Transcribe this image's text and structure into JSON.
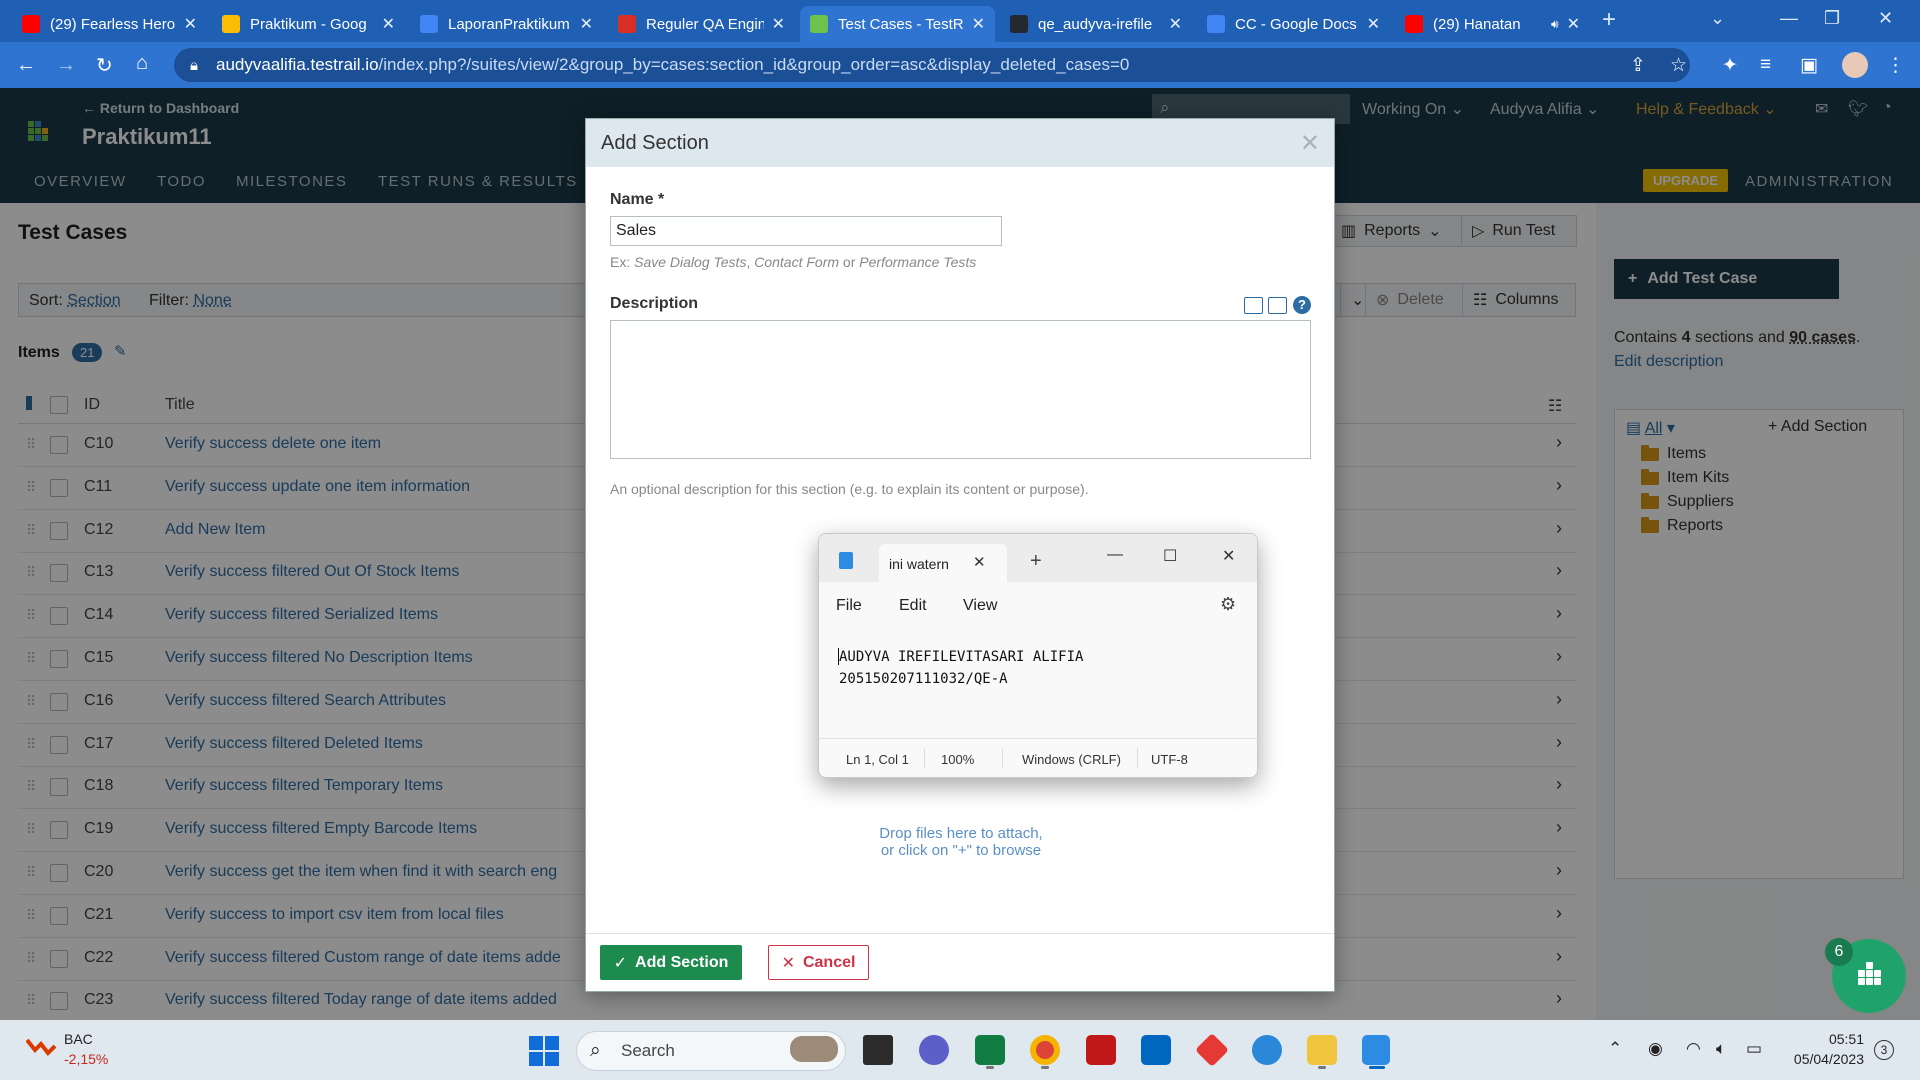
{
  "browser": {
    "tabs": [
      {
        "title": "(29) Fearless Hero",
        "icon": "youtube-icon",
        "color": "#ff0000"
      },
      {
        "title": "Praktikum - Goog",
        "icon": "drive-icon",
        "color": "#fbbc04"
      },
      {
        "title": "LaporanPraktikum",
        "icon": "docs-icon",
        "color": "#4285f4"
      },
      {
        "title": "Reguler QA Engin",
        "icon": "flask-icon",
        "color": "#d93025"
      },
      {
        "title": "Test Cases - TestR",
        "icon": "testrail-icon",
        "color": "#6cc24a"
      },
      {
        "title": "qe_audyva-irefile",
        "icon": "github-icon",
        "color": "#24292f"
      },
      {
        "title": "CC - Google Docs",
        "icon": "docs-icon",
        "color": "#4285f4"
      },
      {
        "title": "(29) Hanatan",
        "icon": "youtube-icon",
        "color": "#ff0000"
      }
    ],
    "url_host": "audyvaalifia.testrail.io",
    "url_path": "/index.php?/suites/view/2&group_by=cases:section_id&group_order=asc&display_deleted_cases=0"
  },
  "header": {
    "back_link": "← Return to Dashboard",
    "project": "Praktikum11",
    "nav": [
      "OVERVIEW",
      "TODO",
      "MILESTONES",
      "TEST RUNS & RESULTS"
    ],
    "working_on": "Working On",
    "user": "Audyva Alifia",
    "help": "Help & Feedback",
    "upgrade": "UPGRADE",
    "admin": "ADMINISTRATION"
  },
  "page": {
    "title": "Test Cases",
    "reports": "Reports",
    "run_test": "Run Test",
    "sort_label": "Sort:",
    "sort_value": "Section",
    "filter_label": "Filter:",
    "filter_value": "None",
    "delete": "Delete",
    "columns": "Columns",
    "items_label": "Items",
    "items_count": "21",
    "col_id": "ID",
    "col_title": "Title",
    "rows": [
      {
        "id": "C10",
        "title": "Verify success delete one item"
      },
      {
        "id": "C11",
        "title": "Verify success update one item information"
      },
      {
        "id": "C12",
        "title": "Add New Item"
      },
      {
        "id": "C13",
        "title": "Verify success filtered Out Of Stock Items"
      },
      {
        "id": "C14",
        "title": "Verify success filtered Serialized Items"
      },
      {
        "id": "C15",
        "title": "Verify success filtered No Description Items"
      },
      {
        "id": "C16",
        "title": "Verify success filtered Search Attributes"
      },
      {
        "id": "C17",
        "title": "Verify success filtered Deleted Items"
      },
      {
        "id": "C18",
        "title": "Verify success filtered Temporary Items"
      },
      {
        "id": "C19",
        "title": "Verify success filtered Empty Barcode Items"
      },
      {
        "id": "C20",
        "title": "Verify success get the item when find it with search eng"
      },
      {
        "id": "C21",
        "title": "Verify success to import csv item from local files"
      },
      {
        "id": "C22",
        "title": "Verify success filtered Custom range of date items adde"
      },
      {
        "id": "C23",
        "title": "Verify success filtered Today range of date items added"
      }
    ]
  },
  "sidebar": {
    "add_case": "Add Test Case",
    "contains_pre": "Contains ",
    "sections_count": "4",
    "contains_mid": " sections and ",
    "cases_count": "90 cases",
    "contains_post": ".",
    "edit_desc": "Edit description",
    "tree_all": "All",
    "tree_add": "Add Section",
    "tree": [
      "Items",
      "Item Kits",
      "Suppliers",
      "Reports"
    ]
  },
  "modal": {
    "title": "Add Section",
    "name_label": "Name *",
    "name_value": "Sales",
    "hint_pre": "Ex: ",
    "hint_1": "Save Dialog Tests",
    "hint_sep1": ", ",
    "hint_2": "Contact Form",
    "hint_sep2": " or ",
    "hint_3": "Performance Tests",
    "desc_label": "Description",
    "desc_hint": "An optional description for this section (e.g. to explain its content or purpose).",
    "drop_line1": "Drop files here to attach,",
    "drop_line2": "or click on \"+\" to browse",
    "add_btn": "Add Section",
    "cancel_btn": "Cancel"
  },
  "notepad": {
    "tab_title": "ini watern",
    "menu": [
      "File",
      "Edit",
      "View"
    ],
    "line1": "AUDYVA IREFILEVITASARI ALIFIA",
    "line2": "205150207111032/QE-A",
    "status": [
      "Ln 1, Col 1",
      "100%",
      "Windows (CRLF)",
      "UTF-8"
    ]
  },
  "chat_badge": "6",
  "taskbar": {
    "stock_name": "BAC",
    "stock_change": "-2,15%",
    "search": "Search",
    "time": "05:51",
    "date": "05/04/2023",
    "notifications": "3"
  }
}
